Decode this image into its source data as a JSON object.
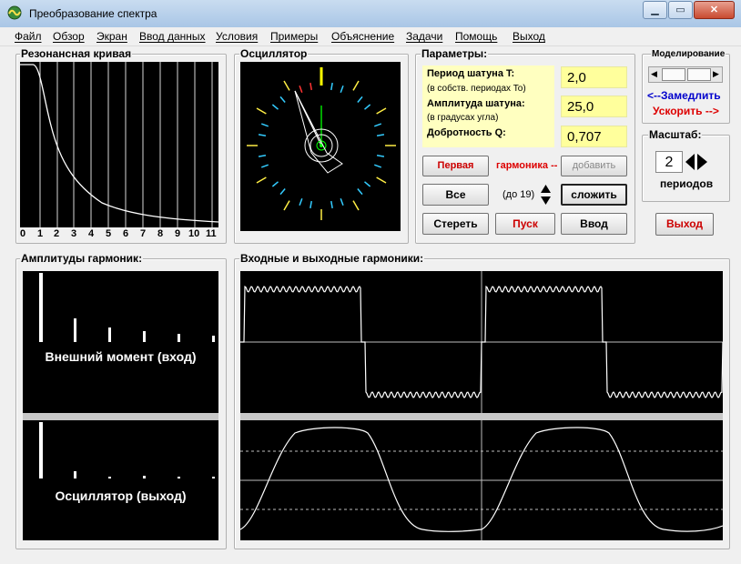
{
  "window": {
    "title": "Преобразование спектра"
  },
  "menu": [
    "Файл",
    "Обзор",
    "Экран",
    "Ввод данных",
    "Условия",
    "Примеры",
    "Объяснение",
    "Задачи",
    "Помощь",
    "Выход"
  ],
  "resonance": {
    "title": "Резонансная кривая",
    "ticks": [
      "0",
      "1",
      "2",
      "3",
      "4",
      "5",
      "6",
      "7",
      "8",
      "9",
      "10",
      "11"
    ]
  },
  "oscillator": {
    "title": "Осциллятор"
  },
  "params": {
    "title": "Параметры:",
    "period_label": "Период шатуна T:",
    "period_sub": "(в собств. периодах To)",
    "period_value": "2,0",
    "amp_label": "Амплитуда шатуна:",
    "amp_sub": "(в градусах угла)",
    "amp_value": "25,0",
    "q_label": "Добротность Q:",
    "q_value": "0,707"
  },
  "controls": {
    "first": "Первая",
    "harmonic": "гармоника --",
    "add": "добавить",
    "all": "Все",
    "up_to": "(до 19)",
    "sum": "сложить",
    "erase": "Стереть",
    "start": "Пуск",
    "input": "Ввод"
  },
  "modeling": {
    "title": "Моделирование",
    "slower": "<--Замедлить",
    "faster": "Ускорить -->"
  },
  "scale": {
    "title": "Масштаб:",
    "value": "2",
    "unit": "периодов"
  },
  "exit": "Выход",
  "amplitudes": {
    "title": "Амплитуды гармоник:",
    "input_label": "Внешний момент (вход)",
    "output_label": "Осциллятор (выход)"
  },
  "harmonics": {
    "title": "Входные и выходные гармоники:"
  },
  "colors": {
    "plot_bg": "#000000",
    "curve": "#ffffff",
    "value_bg": "#ffff9c",
    "red": "#dd0000",
    "blue": "#0000cc"
  }
}
